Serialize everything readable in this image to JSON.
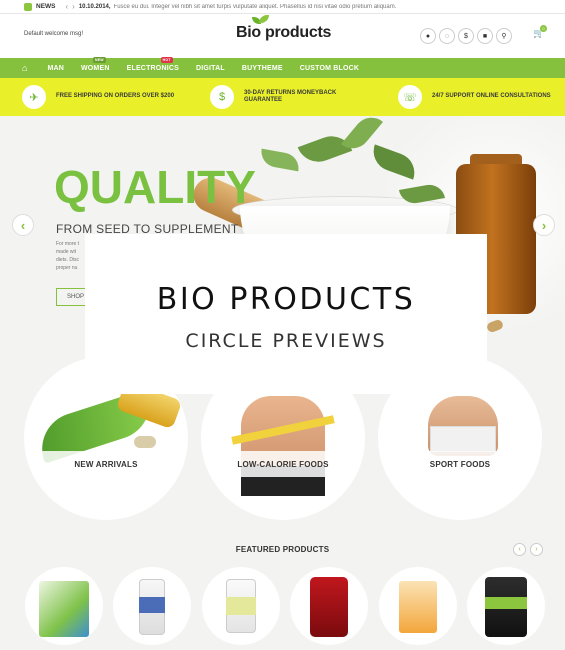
{
  "ticker": {
    "label": "NEWS",
    "date": "10.10.2014,",
    "text": "Fusce eu dui. Integer vel nibh sit amet turpis vulputate aliquet. Phasellus id nisi vitae odio pretium aliquam."
  },
  "header": {
    "welcome": "Default welcome msg!",
    "logo": "Bio products",
    "icons": [
      "user-icon",
      "chat-icon",
      "currency-icon",
      "cart-menu-icon",
      "search-icon"
    ],
    "icon_glyphs": [
      "●",
      "◌",
      "$",
      "■",
      "⚲"
    ],
    "cart_count": "0"
  },
  "nav": {
    "items": [
      {
        "label": "MAN",
        "badge": ""
      },
      {
        "label": "WOMEN",
        "badge": "NEW"
      },
      {
        "label": "ELECTRONICS",
        "badge": "HOT"
      },
      {
        "label": "DIGITAL",
        "badge": ""
      },
      {
        "label": "BUYTHEME",
        "badge": ""
      },
      {
        "label": "CUSTOM BLOCK",
        "badge": ""
      }
    ]
  },
  "features": [
    {
      "icon": "plane-icon",
      "text": "FREE SHIPPING ON ORDERS OVER $200"
    },
    {
      "icon": "money-icon",
      "text": "30-DAY RETURNS MONEYBACK GUARANTEE"
    },
    {
      "icon": "support-icon",
      "text": "24/7 SUPPORT ONLINE CONSULTATIONS"
    }
  ],
  "hero": {
    "heading": "QUALITY",
    "tagline": "FROM SEED TO SUPPLEMENT",
    "body": "For more t made wit diets. Disc proper nu",
    "button": "SHOP"
  },
  "overlay": {
    "title": "BIO PRODUCTS",
    "subtitle": "CIRCLE PREVIEWS"
  },
  "categories": [
    {
      "label": "NEW ARRIVALS"
    },
    {
      "label": "LOW-CALORIE FOODS"
    },
    {
      "label": "SPORT FOODS"
    }
  ],
  "featured": {
    "title": "FEATURED PRODUCTS",
    "products": [
      "",
      "",
      "",
      "",
      "",
      ""
    ]
  },
  "colors": {
    "accent_green": "#85c13d",
    "feature_yellow": "#e9f02a",
    "heading_green": "#7ac142"
  }
}
